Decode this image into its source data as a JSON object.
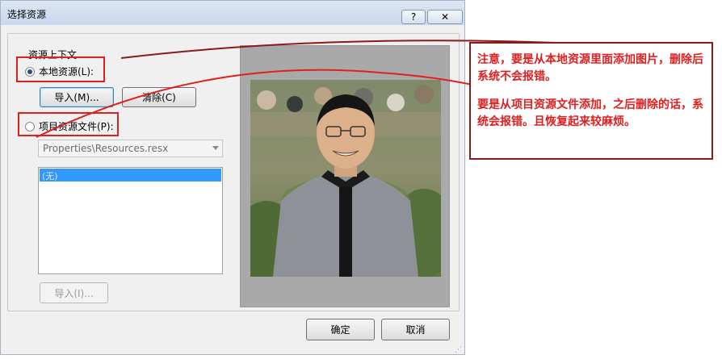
{
  "dialog": {
    "title": "选择资源",
    "help_label": "?",
    "close_label": "✕"
  },
  "context": {
    "group_label": "资源上下文",
    "local_radio": "本地资源(L):",
    "import_button": "导入(M)...",
    "clear_button": "清除(C)",
    "project_radio": "项目资源文件(P):",
    "resource_file": "Properties\\Resources.resx",
    "list_items": [
      "(无)"
    ],
    "project_import_button": "导入(I)..."
  },
  "footer": {
    "ok_button": "确定",
    "cancel_button": "取消"
  },
  "annotation": {
    "line1": "注意，要是从本地资源里面添加图片，删除后系统不会报错。",
    "line2": "要是从项目资源文件添加，之后删除的话，系统会报错。且恢复起来较麻烦。",
    "color": "#e01e1e",
    "border_color": "#8b1a1a"
  },
  "highlight_color": "#e02020"
}
